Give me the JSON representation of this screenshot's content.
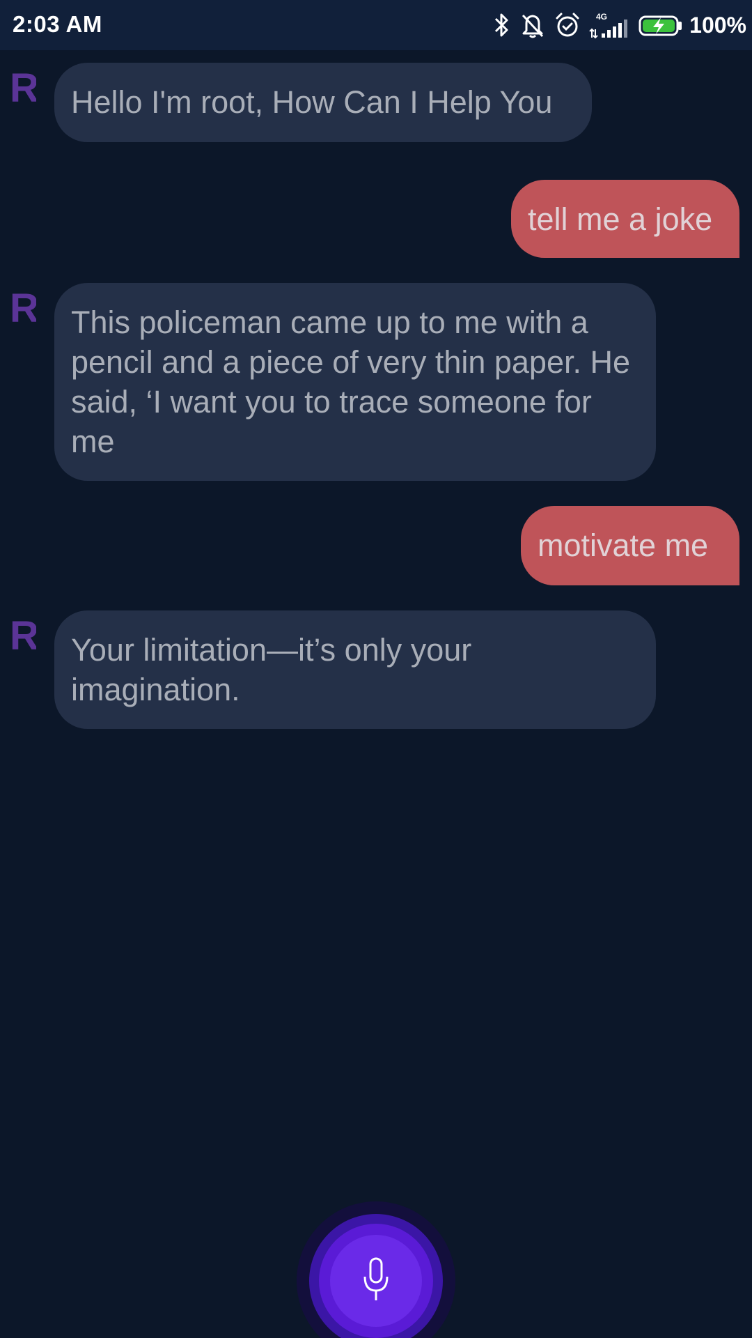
{
  "status_bar": {
    "time": "2:03 AM",
    "network_type": "4G",
    "battery_percent": "100%",
    "icons": [
      "bluetooth-icon",
      "bell-off-icon",
      "alarm-icon",
      "signal-icon",
      "battery-charging-icon"
    ]
  },
  "chat": {
    "avatar_letter": "R",
    "messages": [
      {
        "sender": "bot",
        "text": "Hello I'm root, How Can I Help You"
      },
      {
        "sender": "user",
        "text": "tell me a joke"
      },
      {
        "sender": "bot",
        "text": "This policeman came up to me with a pencil and a piece of very thin paper. He said, ‘I want you to trace someone for me"
      },
      {
        "sender": "user",
        "text": "motivate me"
      },
      {
        "sender": "bot",
        "text": "Your limitation—it’s only your imagination."
      }
    ]
  },
  "mic": {
    "icon": "microphone-icon"
  },
  "colors": {
    "background": "#0c1729",
    "status_bar": "#11203a",
    "bot_bubble": "#243048",
    "user_bubble": "#bf5459",
    "avatar": "#5b3497",
    "mic_accent": "#6a2ae8"
  }
}
